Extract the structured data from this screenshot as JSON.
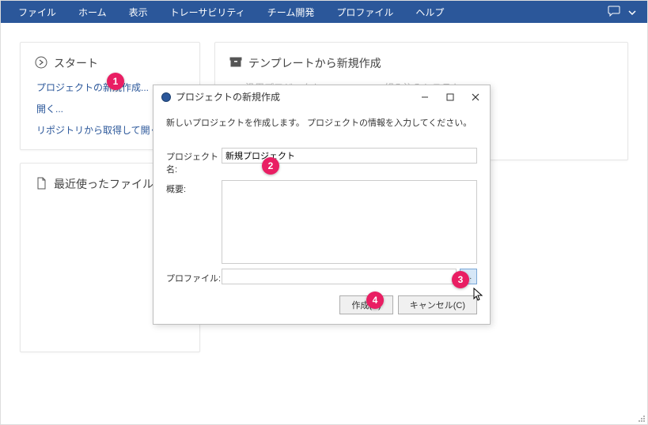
{
  "menu": {
    "items": [
      "ファイル",
      "ホーム",
      "表示",
      "トレーサビリティ",
      "チーム開発",
      "プロファイル",
      "ヘルプ"
    ]
  },
  "start": {
    "title": "スタート",
    "links": [
      "プロジェクトの新規作成...",
      "開く...",
      "リポジトリから取得して開く..."
    ]
  },
  "recent": {
    "title": "最近使ったファイル"
  },
  "template": {
    "title": "テンプレートから新規作成",
    "items": [
      "汎用プロジェクト",
      "組み込みシステム"
    ]
  },
  "dialog": {
    "title": "プロジェクトの新規作成",
    "description": "新しいプロジェクトを作成します。 プロジェクトの情報を入力してください。",
    "labels": {
      "name": "プロジェクト名:",
      "summary": "概要:",
      "profile": "プロファイル:"
    },
    "values": {
      "name": "新規プロジェクト",
      "summary": "",
      "profile": ""
    },
    "browse": "...",
    "buttons": {
      "create": "作成(R)",
      "cancel": "キャンセル(C)"
    }
  },
  "callouts": [
    "1",
    "2",
    "3",
    "4"
  ]
}
